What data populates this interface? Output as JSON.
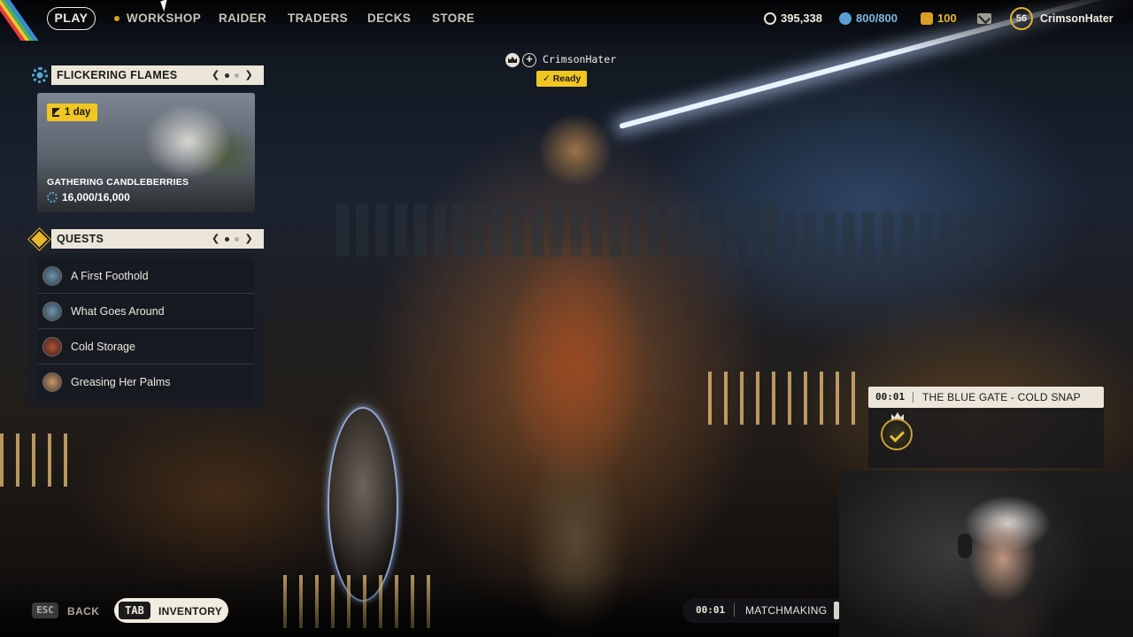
{
  "nav": {
    "play": "PLAY",
    "items": [
      "WORKSHOP",
      "RAIDER",
      "TRADERS",
      "DECKS",
      "STORE"
    ],
    "accent_color": "#f0c623"
  },
  "currencies": {
    "coins": "395,338",
    "seeds": "800/800",
    "tokens": "100"
  },
  "player": {
    "level": "56",
    "name": "CrimsonHater"
  },
  "event": {
    "title": "FLICKERING FLAMES",
    "time_left": "1 day",
    "name": "GATHERING CANDLEBERRIES",
    "progress": "16,000/16,000"
  },
  "quests": {
    "title": "QUESTS",
    "items": [
      {
        "label": "A First Foothold"
      },
      {
        "label": "What Goes Around"
      },
      {
        "label": "Cold Storage"
      },
      {
        "label": "Greasing Her Palms"
      }
    ]
  },
  "squad": {
    "leader_name": "CrimsonHater",
    "status": "Ready"
  },
  "match": {
    "timer": "00:01",
    "title": "THE BLUE GATE - COLD SNAP"
  },
  "bottom": {
    "esc_key": "ESC",
    "back_label": "BACK",
    "tab_key": "TAB",
    "inventory_label": "INVENTORY",
    "mm_timer": "00:01",
    "mm_label": "MATCHMAKING"
  },
  "icons": {
    "event": "gear-icon",
    "quests": "diamond-icon",
    "squad_leader": "crown-icon",
    "invite": "plus-icon",
    "mail": "mail-icon"
  }
}
